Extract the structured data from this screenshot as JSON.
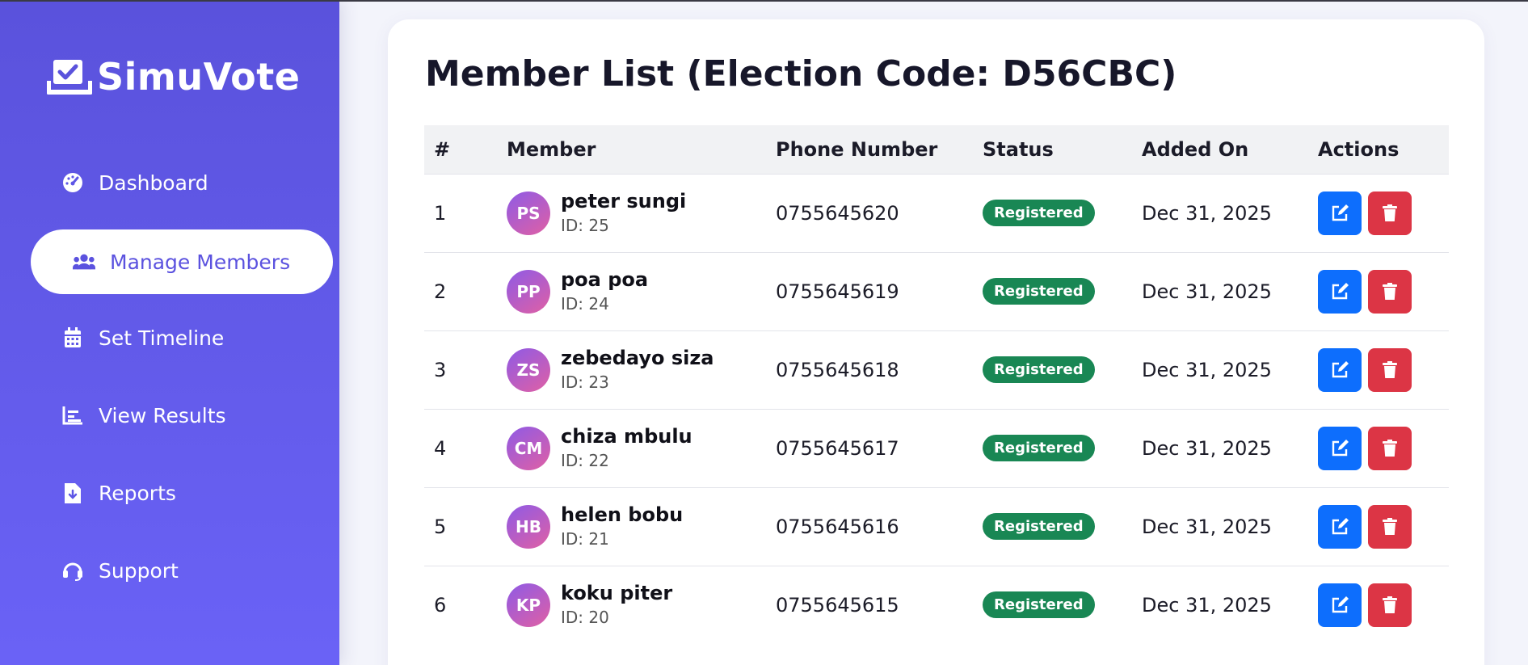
{
  "brand": {
    "name": "SimuVote",
    "icon": "check-box-icon"
  },
  "nav": [
    {
      "label": "Dashboard",
      "icon": "gauge-icon",
      "active": false
    },
    {
      "label": "Manage Members",
      "icon": "users-icon",
      "active": true
    },
    {
      "label": "Set Timeline",
      "icon": "calendar-icon",
      "active": false
    },
    {
      "label": "View Results",
      "icon": "chart-icon",
      "active": false
    },
    {
      "label": "Reports",
      "icon": "file-download-icon",
      "active": false
    },
    {
      "label": "Support",
      "icon": "headset-icon",
      "active": false
    }
  ],
  "page": {
    "title": "Member List (Election Code: D56CBC)"
  },
  "table": {
    "headers": [
      "#",
      "Member",
      "Phone Number",
      "Status",
      "Added On",
      "Actions"
    ],
    "rows": [
      {
        "num": "1",
        "initials": "PS",
        "name": "peter sungi",
        "id": "ID: 25",
        "phone": "0755645620",
        "status": "Registered",
        "added": "Dec 31, 2025"
      },
      {
        "num": "2",
        "initials": "PP",
        "name": "poa poa",
        "id": "ID: 24",
        "phone": "0755645619",
        "status": "Registered",
        "added": "Dec 31, 2025"
      },
      {
        "num": "3",
        "initials": "ZS",
        "name": "zebedayo siza",
        "id": "ID: 23",
        "phone": "0755645618",
        "status": "Registered",
        "added": "Dec 31, 2025"
      },
      {
        "num": "4",
        "initials": "CM",
        "name": "chiza mbulu",
        "id": "ID: 22",
        "phone": "0755645617",
        "status": "Registered",
        "added": "Dec 31, 2025"
      },
      {
        "num": "5",
        "initials": "HB",
        "name": "helen bobu",
        "id": "ID: 21",
        "phone": "0755645616",
        "status": "Registered",
        "added": "Dec 31, 2025"
      },
      {
        "num": "6",
        "initials": "KP",
        "name": "koku piter",
        "id": "ID: 20",
        "phone": "0755645615",
        "status": "Registered",
        "added": "Dec 31, 2025"
      }
    ]
  },
  "colors": {
    "sidebar_top": "#5a52dc",
    "sidebar_bottom": "#6a62f6",
    "accent": "#5b52df",
    "status_registered": "#198754",
    "edit": "#0d6efd",
    "delete": "#dc3545"
  }
}
